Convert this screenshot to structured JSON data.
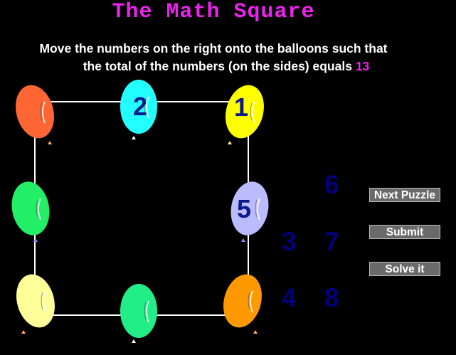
{
  "game": {
    "title": "The Math Square",
    "instruction_line1": "Move the numbers on the right onto the balloons such that",
    "instruction_line2": "the total of the numbers (on the sides) equals ",
    "target": "13"
  },
  "balloons": [
    {
      "id": "top-left",
      "color": "#ff6633",
      "value": ""
    },
    {
      "id": "top-middle",
      "color": "#22ffff",
      "value": "2"
    },
    {
      "id": "top-right",
      "color": "#ffff00",
      "value": "1"
    },
    {
      "id": "middle-left",
      "color": "#22ee66",
      "value": ""
    },
    {
      "id": "middle-right",
      "color": "#bbbbff",
      "value": "5"
    },
    {
      "id": "bottom-left",
      "color": "#ffff99",
      "value": ""
    },
    {
      "id": "bottom-middle",
      "color": "#22ee88",
      "value": ""
    },
    {
      "id": "bottom-right",
      "color": "#ff9900",
      "value": ""
    }
  ],
  "available_numbers": [
    "6",
    "3",
    "7",
    "4",
    "8"
  ],
  "buttons": {
    "next_puzzle": "Next Puzzle",
    "submit": "Submit",
    "solve_it": "Solve it"
  }
}
